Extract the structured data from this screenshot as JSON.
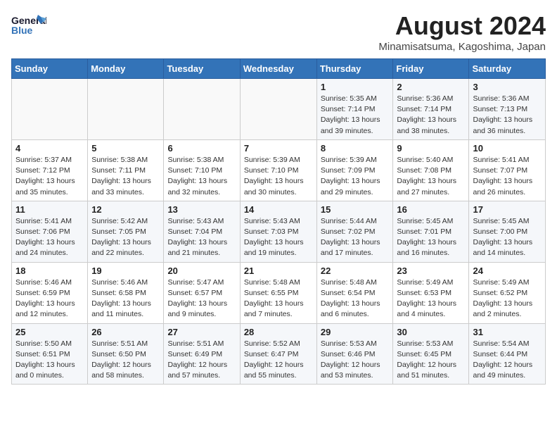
{
  "logo": {
    "general": "General",
    "blue": "Blue"
  },
  "title": {
    "month_year": "August 2024",
    "location": "Minamisatsuma, Kagoshima, Japan"
  },
  "headers": [
    "Sunday",
    "Monday",
    "Tuesday",
    "Wednesday",
    "Thursday",
    "Friday",
    "Saturday"
  ],
  "weeks": [
    [
      {
        "day": "",
        "info": ""
      },
      {
        "day": "",
        "info": ""
      },
      {
        "day": "",
        "info": ""
      },
      {
        "day": "",
        "info": ""
      },
      {
        "day": "1",
        "info": "Sunrise: 5:35 AM\nSunset: 7:14 PM\nDaylight: 13 hours\nand 39 minutes."
      },
      {
        "day": "2",
        "info": "Sunrise: 5:36 AM\nSunset: 7:14 PM\nDaylight: 13 hours\nand 38 minutes."
      },
      {
        "day": "3",
        "info": "Sunrise: 5:36 AM\nSunset: 7:13 PM\nDaylight: 13 hours\nand 36 minutes."
      }
    ],
    [
      {
        "day": "4",
        "info": "Sunrise: 5:37 AM\nSunset: 7:12 PM\nDaylight: 13 hours\nand 35 minutes."
      },
      {
        "day": "5",
        "info": "Sunrise: 5:38 AM\nSunset: 7:11 PM\nDaylight: 13 hours\nand 33 minutes."
      },
      {
        "day": "6",
        "info": "Sunrise: 5:38 AM\nSunset: 7:10 PM\nDaylight: 13 hours\nand 32 minutes."
      },
      {
        "day": "7",
        "info": "Sunrise: 5:39 AM\nSunset: 7:10 PM\nDaylight: 13 hours\nand 30 minutes."
      },
      {
        "day": "8",
        "info": "Sunrise: 5:39 AM\nSunset: 7:09 PM\nDaylight: 13 hours\nand 29 minutes."
      },
      {
        "day": "9",
        "info": "Sunrise: 5:40 AM\nSunset: 7:08 PM\nDaylight: 13 hours\nand 27 minutes."
      },
      {
        "day": "10",
        "info": "Sunrise: 5:41 AM\nSunset: 7:07 PM\nDaylight: 13 hours\nand 26 minutes."
      }
    ],
    [
      {
        "day": "11",
        "info": "Sunrise: 5:41 AM\nSunset: 7:06 PM\nDaylight: 13 hours\nand 24 minutes."
      },
      {
        "day": "12",
        "info": "Sunrise: 5:42 AM\nSunset: 7:05 PM\nDaylight: 13 hours\nand 22 minutes."
      },
      {
        "day": "13",
        "info": "Sunrise: 5:43 AM\nSunset: 7:04 PM\nDaylight: 13 hours\nand 21 minutes."
      },
      {
        "day": "14",
        "info": "Sunrise: 5:43 AM\nSunset: 7:03 PM\nDaylight: 13 hours\nand 19 minutes."
      },
      {
        "day": "15",
        "info": "Sunrise: 5:44 AM\nSunset: 7:02 PM\nDaylight: 13 hours\nand 17 minutes."
      },
      {
        "day": "16",
        "info": "Sunrise: 5:45 AM\nSunset: 7:01 PM\nDaylight: 13 hours\nand 16 minutes."
      },
      {
        "day": "17",
        "info": "Sunrise: 5:45 AM\nSunset: 7:00 PM\nDaylight: 13 hours\nand 14 minutes."
      }
    ],
    [
      {
        "day": "18",
        "info": "Sunrise: 5:46 AM\nSunset: 6:59 PM\nDaylight: 13 hours\nand 12 minutes."
      },
      {
        "day": "19",
        "info": "Sunrise: 5:46 AM\nSunset: 6:58 PM\nDaylight: 13 hours\nand 11 minutes."
      },
      {
        "day": "20",
        "info": "Sunrise: 5:47 AM\nSunset: 6:57 PM\nDaylight: 13 hours\nand 9 minutes."
      },
      {
        "day": "21",
        "info": "Sunrise: 5:48 AM\nSunset: 6:55 PM\nDaylight: 13 hours\nand 7 minutes."
      },
      {
        "day": "22",
        "info": "Sunrise: 5:48 AM\nSunset: 6:54 PM\nDaylight: 13 hours\nand 6 minutes."
      },
      {
        "day": "23",
        "info": "Sunrise: 5:49 AM\nSunset: 6:53 PM\nDaylight: 13 hours\nand 4 minutes."
      },
      {
        "day": "24",
        "info": "Sunrise: 5:49 AM\nSunset: 6:52 PM\nDaylight: 13 hours\nand 2 minutes."
      }
    ],
    [
      {
        "day": "25",
        "info": "Sunrise: 5:50 AM\nSunset: 6:51 PM\nDaylight: 13 hours\nand 0 minutes."
      },
      {
        "day": "26",
        "info": "Sunrise: 5:51 AM\nSunset: 6:50 PM\nDaylight: 12 hours\nand 58 minutes."
      },
      {
        "day": "27",
        "info": "Sunrise: 5:51 AM\nSunset: 6:49 PM\nDaylight: 12 hours\nand 57 minutes."
      },
      {
        "day": "28",
        "info": "Sunrise: 5:52 AM\nSunset: 6:47 PM\nDaylight: 12 hours\nand 55 minutes."
      },
      {
        "day": "29",
        "info": "Sunrise: 5:53 AM\nSunset: 6:46 PM\nDaylight: 12 hours\nand 53 minutes."
      },
      {
        "day": "30",
        "info": "Sunrise: 5:53 AM\nSunset: 6:45 PM\nDaylight: 12 hours\nand 51 minutes."
      },
      {
        "day": "31",
        "info": "Sunrise: 5:54 AM\nSunset: 6:44 PM\nDaylight: 12 hours\nand 49 minutes."
      }
    ]
  ]
}
